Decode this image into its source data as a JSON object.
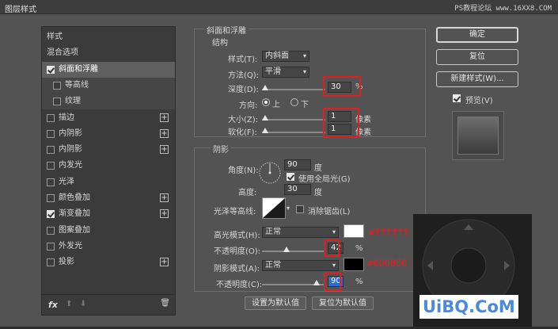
{
  "window": {
    "title": "图层样式",
    "watermark": "PS教程论坛 www.16XX8.COM"
  },
  "sidebar": {
    "items": [
      {
        "label": "样式",
        "checkbox": false,
        "plus": false,
        "sub": false,
        "checked": false
      },
      {
        "label": "混合选项",
        "checkbox": false,
        "plus": false,
        "sub": false,
        "checked": false
      },
      {
        "label": "斜面和浮雕",
        "checkbox": true,
        "plus": false,
        "sub": false,
        "checked": true
      },
      {
        "label": "等高线",
        "checkbox": true,
        "plus": false,
        "sub": true,
        "checked": false
      },
      {
        "label": "纹理",
        "checkbox": true,
        "plus": false,
        "sub": true,
        "checked": false
      },
      {
        "label": "描边",
        "checkbox": true,
        "plus": true,
        "sub": false,
        "checked": false
      },
      {
        "label": "内阴影",
        "checkbox": true,
        "plus": true,
        "sub": false,
        "checked": false
      },
      {
        "label": "内阴影",
        "checkbox": true,
        "plus": true,
        "sub": false,
        "checked": false
      },
      {
        "label": "内发光",
        "checkbox": true,
        "plus": false,
        "sub": false,
        "checked": false
      },
      {
        "label": "光泽",
        "checkbox": true,
        "plus": false,
        "sub": false,
        "checked": false
      },
      {
        "label": "颜色叠加",
        "checkbox": true,
        "plus": true,
        "sub": false,
        "checked": false
      },
      {
        "label": "渐变叠加",
        "checkbox": true,
        "plus": true,
        "sub": false,
        "checked": true
      },
      {
        "label": "图案叠加",
        "checkbox": true,
        "plus": false,
        "sub": false,
        "checked": false
      },
      {
        "label": "外发光",
        "checkbox": true,
        "plus": false,
        "sub": false,
        "checked": false
      },
      {
        "label": "投影",
        "checkbox": true,
        "plus": true,
        "sub": false,
        "checked": false
      }
    ],
    "footer": {
      "fx": "fx",
      "up": "⬆",
      "down": "⬇",
      "trash": "🗑"
    }
  },
  "bevel": {
    "group_title": "斜面和浮雕",
    "structure_title": "结构",
    "style_label": "样式(T):",
    "style_value": "内斜面",
    "technique_label": "方法(Q):",
    "technique_value": "平滑",
    "depth_label": "深度(D):",
    "depth_value": "30",
    "depth_unit": "%",
    "direction_label": "方向:",
    "dir_up": "上",
    "dir_down": "下",
    "size_label": "大小(Z):",
    "size_value": "1",
    "size_unit": "像素",
    "soften_label": "软化(F):",
    "soften_value": "1",
    "soften_unit": "像素"
  },
  "shading": {
    "title": "阴影",
    "angle_label": "角度(N):",
    "angle_value": "90",
    "angle_unit": "度",
    "global_light_label": "使用全局光(G)",
    "altitude_label": "高度:",
    "altitude_value": "30",
    "altitude_unit": "度",
    "gloss_label": "光泽等高线:",
    "antialias_label": "消除锯齿(L)",
    "highlight_label": "高光模式(H):",
    "highlight_mode": "正常",
    "highlight_color": "#ffffff",
    "highlight_opacity_label": "不透明度(O):",
    "highlight_opacity": "42",
    "highlight_opacity_unit": "%",
    "shadow_label": "阴影模式(A):",
    "shadow_mode": "正常",
    "shadow_color": "#000000",
    "shadow_opacity_label": "不透明度(C):",
    "shadow_opacity": "90",
    "shadow_opacity_unit": "%"
  },
  "bottom_buttons": {
    "make_default": "设置为默认值",
    "reset_default": "复位为默认值"
  },
  "right": {
    "ok": "确定",
    "reset": "复位",
    "new_style": "新建样式(W)...",
    "preview_label": "预览(V)"
  },
  "annotations": {
    "white_hex": "#ffffff",
    "black_hex": "#000000"
  },
  "logo": "UiBQ.CoM"
}
